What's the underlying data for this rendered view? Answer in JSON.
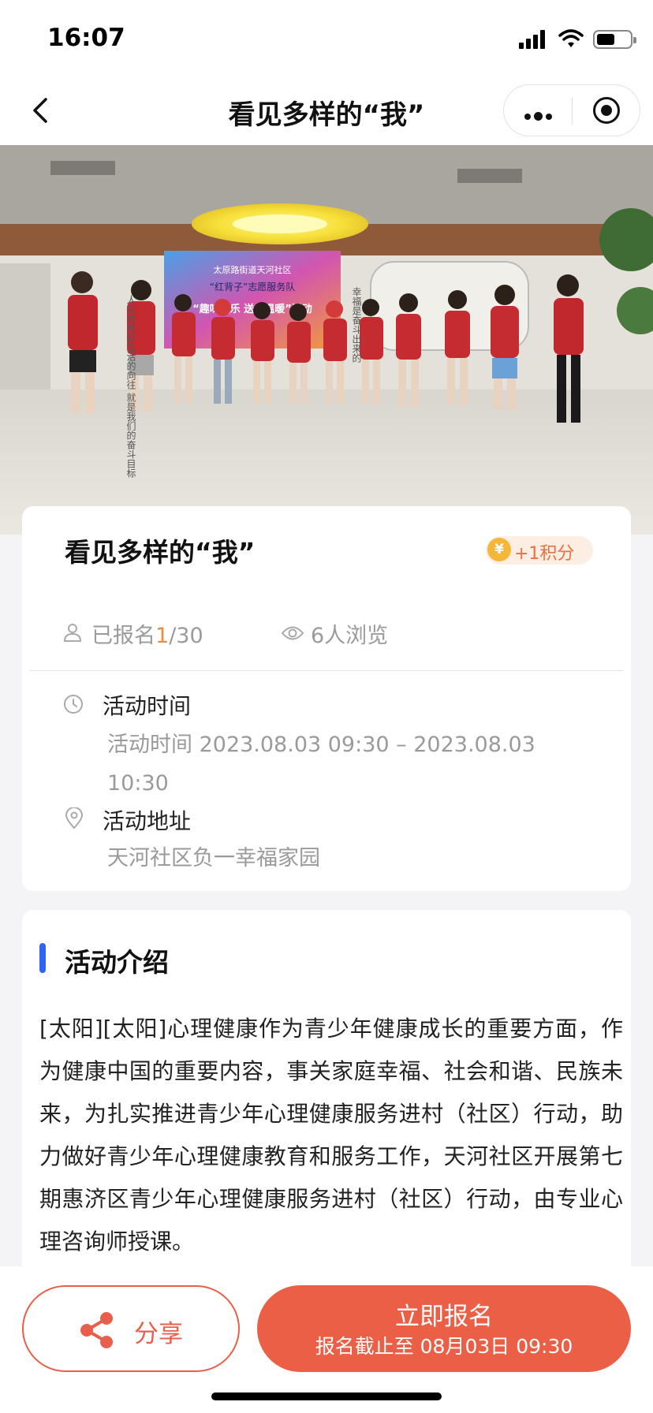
{
  "status_bar": {
    "time": "16:07"
  },
  "nav": {
    "title": "看见多样的“我”"
  },
  "banner": {
    "banner_text_1": "太原路街道天河社区",
    "banner_text_2": "“红背子”志愿服务队",
    "banner_text_3": "“趣味快乐 送夕温暖”活动",
    "wall_text_left": "人民对美好生活的向往 就是我们的奋斗目标",
    "wall_text_right": "幸福是奋斗出来的"
  },
  "activity": {
    "title": "看见多样的“我”",
    "points_badge": "+1积分",
    "coin_symbol": "¥",
    "signup_prefix": "已报名",
    "signup_count": "1",
    "signup_total": "/30",
    "views": "6人浏览",
    "time_label": "活动时间",
    "time_value": "活动时间 2023.08.03 09:30 – 2023.08.03 10:30",
    "address_label": "活动地址",
    "address_value": "天河社区负一幸福家园"
  },
  "intro": {
    "heading": "活动介绍",
    "body": "[太阳][太阳]心理健康作为青少年健康成长的重要方面，作为健康中国的重要内容，事关家庭幸福、社会和谐、民族未来，为扎实推进青少年心理健康服务进村（社区）行动，助力做好青少年心理健康教育和服务工作，天河社区开展第七期惠济区青少年心理健康服务进村（社区）行动，由专业心理咨询师授课。"
  },
  "actions": {
    "share_label": "分享",
    "signup_label": "立即报名",
    "signup_deadline": "报名截止至 08月03日 09:30"
  },
  "colors": {
    "accent": "#ea5f46",
    "blue_accent": "#2f63f2",
    "points_orange": "#e8713f",
    "signup_highlight": "#f08a3c"
  }
}
